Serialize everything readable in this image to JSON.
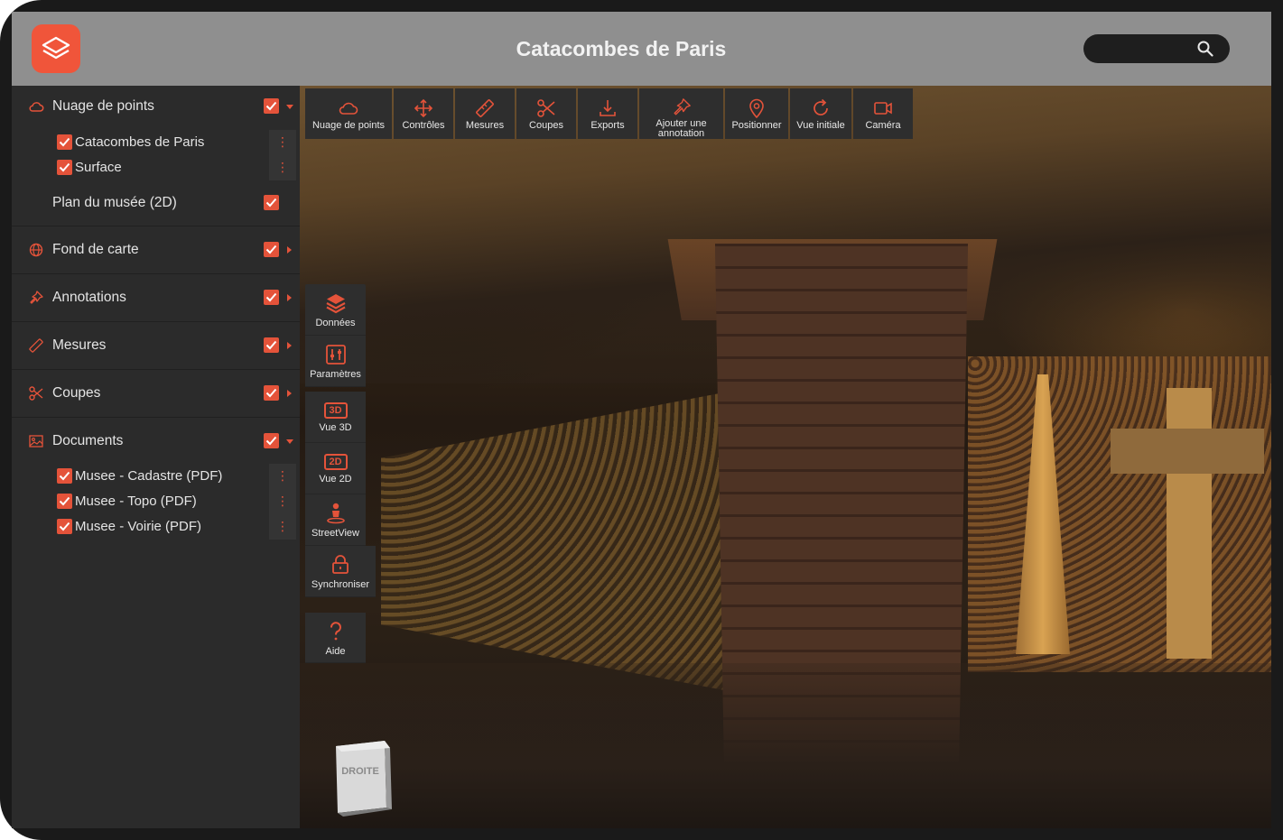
{
  "app": {
    "title": "Catacombes de Paris",
    "accent_color": "#e4533a",
    "logo_icon": "layers-icon"
  },
  "search": {
    "placeholder": "",
    "icon": "search-icon"
  },
  "sidebar": {
    "sections": [
      {
        "label": "Nuage de points",
        "icon": "cloud-icon",
        "checked": true,
        "expanded": true,
        "items": [
          {
            "label": "Catacombes de Paris",
            "checked": true
          },
          {
            "label": "Surface",
            "checked": true
          }
        ],
        "extra": {
          "label": "Plan du musée (2D)",
          "checked": true
        }
      },
      {
        "label": "Fond de carte",
        "icon": "globe-icon",
        "checked": true,
        "expanded": false
      },
      {
        "label": "Annotations",
        "icon": "pin-icon",
        "checked": true,
        "expanded": false
      },
      {
        "label": "Mesures",
        "icon": "ruler-icon",
        "checked": true,
        "expanded": false
      },
      {
        "label": "Coupes",
        "icon": "scissors-icon",
        "checked": true,
        "expanded": false
      },
      {
        "label": "Documents",
        "icon": "image-icon",
        "checked": true,
        "expanded": true,
        "items": [
          {
            "label": "Musee - Cadastre (PDF)",
            "checked": true
          },
          {
            "label": "Musee - Topo (PDF)",
            "checked": true
          },
          {
            "label": "Musee - Voirie (PDF)",
            "checked": true
          }
        ]
      }
    ],
    "menu_glyph": "⋮"
  },
  "toolbar": {
    "tools": [
      {
        "label": "Nuage de points",
        "icon": "cloud-icon"
      },
      {
        "label": "Contrôles",
        "icon": "move-icon"
      },
      {
        "label": "Mesures",
        "icon": "ruler-icon"
      },
      {
        "label": "Coupes",
        "icon": "scissors-icon"
      },
      {
        "label": "Exports",
        "icon": "download-icon"
      },
      {
        "label": "Ajouter une annotation",
        "icon": "pin-icon"
      },
      {
        "label": "Positionner",
        "icon": "map-pin-icon"
      },
      {
        "label": "Vue initiale",
        "icon": "refresh-icon"
      },
      {
        "label": "Caméra",
        "icon": "video-icon"
      }
    ]
  },
  "side_tools": {
    "donnees": {
      "label": "Données",
      "icon": "layers-icon"
    },
    "parametres": {
      "label": "Paramètres",
      "icon": "sliders-icon"
    },
    "vue3d": {
      "label": "Vue 3D",
      "badge": "3D"
    },
    "vue2d": {
      "label": "Vue 2D",
      "badge": "2D"
    },
    "streetview": {
      "label": "StreetView",
      "icon": "person-icon"
    },
    "synchroniser": {
      "label": "Synchroniser",
      "icon": "lock-icon"
    },
    "aide": {
      "label": "Aide",
      "icon": "question-icon"
    }
  },
  "nav_cube": {
    "face_label": "DROITE"
  }
}
